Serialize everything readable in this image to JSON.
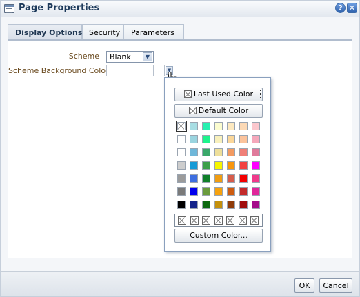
{
  "window": {
    "title": "Page Properties",
    "help_glyph": "?",
    "close_glyph": "✕"
  },
  "tabs": [
    {
      "label": "Display Options",
      "active": true
    },
    {
      "label": "Security",
      "active": false
    },
    {
      "label": "Parameters",
      "active": false
    }
  ],
  "form": {
    "scheme_label": "Scheme",
    "scheme_value": "Blank",
    "bg_label": "Scheme Background Color",
    "bg_value": ""
  },
  "picker": {
    "last_used_label": "Last Used Color",
    "default_label": "Default Color",
    "custom_label": "Custom Color...",
    "palette": [
      [
        "none",
        "#a7dde3",
        "#27f0b0",
        "#fbfccf",
        "#fde9c0",
        "#fcd9b5",
        "#fbc7cd"
      ],
      [
        "#ffffff",
        "#9ad4df",
        "#1ef48c",
        "#f8f0bc",
        "#fbd79a",
        "#fbc39c",
        "#f5a8bb"
      ],
      [
        "#ffffff",
        "#6fb7d9",
        "#3aa86a",
        "#eedf9a",
        "#f39b62",
        "#f07f77",
        "#e07a9b"
      ],
      [
        "#cdcdcd",
        "#169ad6",
        "#3c9f4b",
        "#f6f500",
        "#f8960d",
        "#f24242",
        "#ff00ff"
      ],
      [
        "#9b9b9b",
        "#3d6ee0",
        "#10802a",
        "#f09d12",
        "#d65d4c",
        "#f30000",
        "#f03a8a"
      ],
      [
        "#7a7a7a",
        "#0000ee",
        "#6a9b3d",
        "#f6a20f",
        "#cd5c11",
        "#c32b2b",
        "#e0269a"
      ],
      [
        "#000000",
        "#14238a",
        "#0b6810",
        "#c4900c",
        "#8f3c0a",
        "#a10d0d",
        "#a40c8a"
      ]
    ],
    "recent_count": 7
  },
  "footer": {
    "ok_label": "OK",
    "cancel_label": "Cancel"
  }
}
